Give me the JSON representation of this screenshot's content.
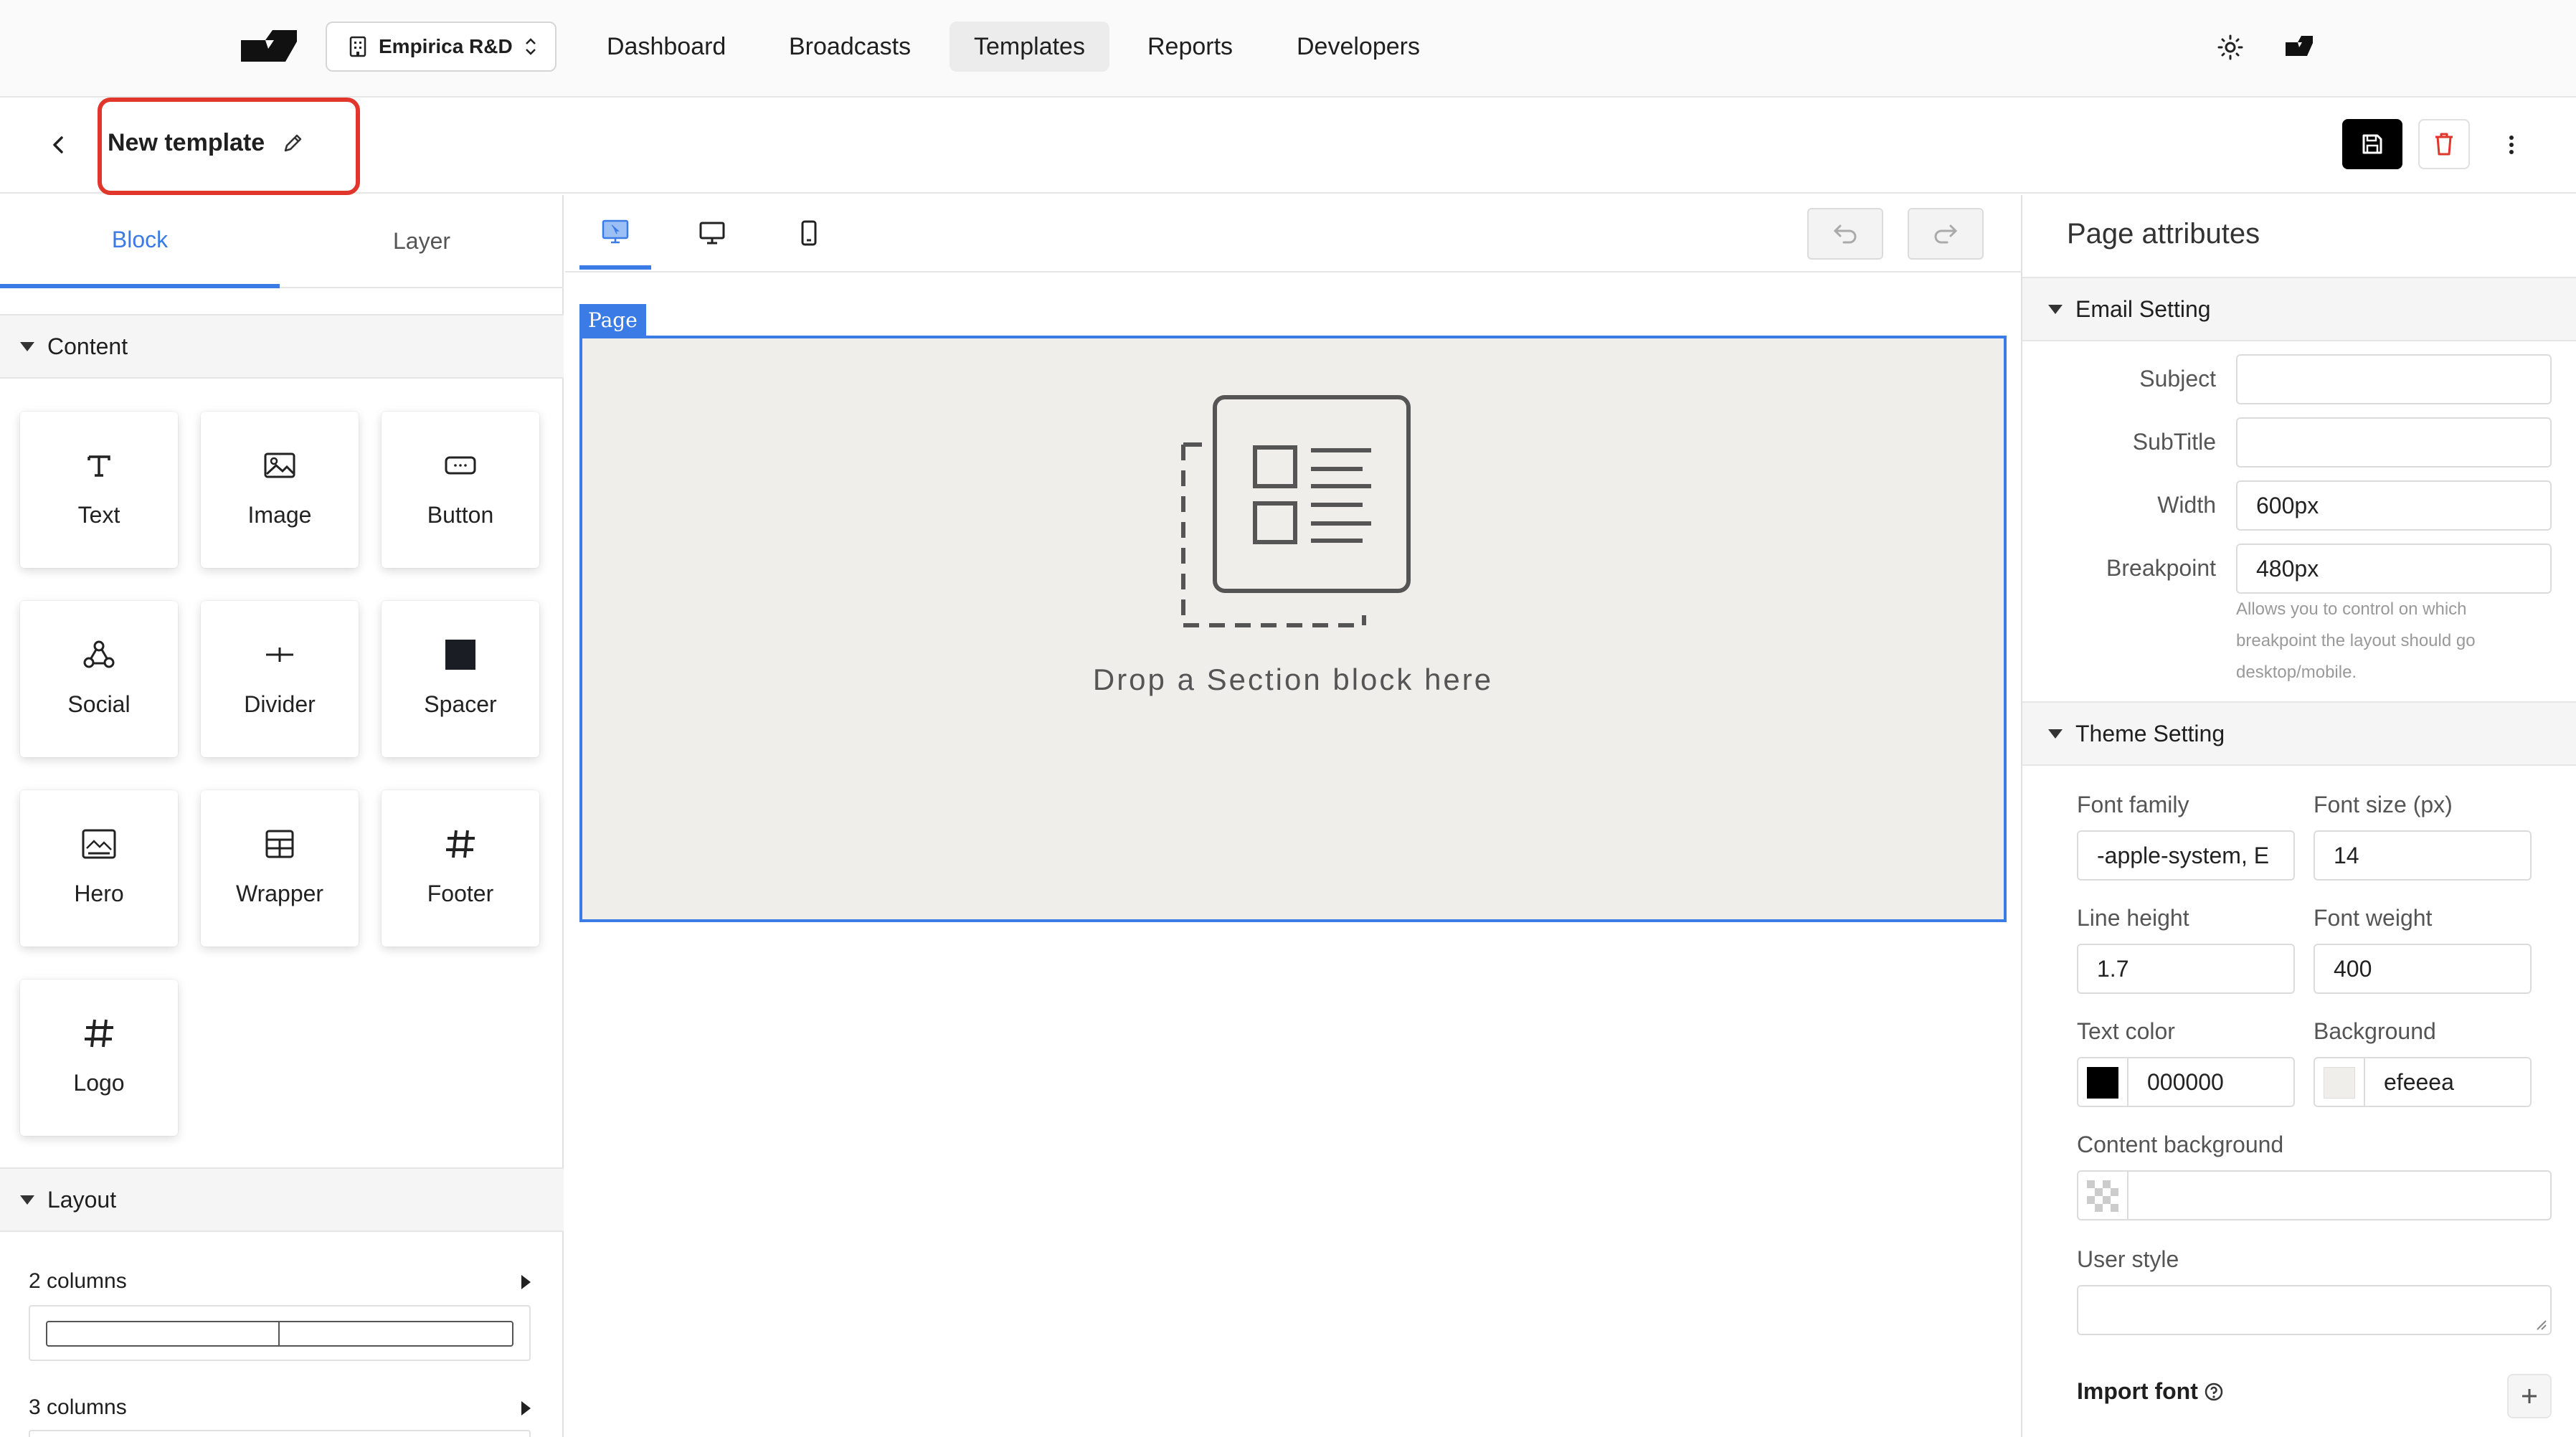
{
  "nav": {
    "org": "Empirica R&D",
    "links": [
      "Dashboard",
      "Broadcasts",
      "Templates",
      "Reports",
      "Developers"
    ],
    "active": "Templates"
  },
  "header": {
    "title": "New template"
  },
  "left_panel": {
    "tabs": [
      "Block",
      "Layer"
    ],
    "active_tab": "Block",
    "content_section": "Content",
    "blocks": [
      {
        "label": "Text",
        "icon": "text-icon"
      },
      {
        "label": "Image",
        "icon": "image-icon"
      },
      {
        "label": "Button",
        "icon": "button-icon"
      },
      {
        "label": "Social",
        "icon": "social-icon"
      },
      {
        "label": "Divider",
        "icon": "divider-icon"
      },
      {
        "label": "Spacer",
        "icon": "spacer-icon"
      },
      {
        "label": "Hero",
        "icon": "hero-icon"
      },
      {
        "label": "Wrapper",
        "icon": "wrapper-icon"
      },
      {
        "label": "Footer",
        "icon": "hash-icon"
      },
      {
        "label": "Logo",
        "icon": "hash-icon"
      }
    ],
    "layout_section": "Layout",
    "layouts": [
      "2 columns",
      "3 columns"
    ]
  },
  "canvas": {
    "page_tag": "Page",
    "drop_text": "Drop a Section block here",
    "page_background": "#efeeea",
    "accent": "#3a7be5"
  },
  "right_panel": {
    "title": "Page attributes",
    "email_setting": {
      "heading": "Email Setting",
      "subject_label": "Subject",
      "subject_value": "",
      "subtitle_label": "SubTitle",
      "subtitle_value": "",
      "width_label": "Width",
      "width_value": "600px",
      "breakpoint_label": "Breakpoint",
      "breakpoint_value": "480px",
      "breakpoint_hint": [
        "Allows you to control on which",
        "breakpoint the layout should go",
        "desktop/mobile."
      ]
    },
    "theme_setting": {
      "heading": "Theme Setting",
      "font_family_label": "Font family",
      "font_family_value": "-apple-system, E",
      "font_size_label": "Font size (px)",
      "font_size_value": "14",
      "line_height_label": "Line height",
      "line_height_value": "1.7",
      "font_weight_label": "Font weight",
      "font_weight_value": "400",
      "text_color_label": "Text color",
      "text_color_value": "000000",
      "text_color_hex": "#000000",
      "background_label": "Background",
      "background_value": "efeeea",
      "background_hex": "#efeeea",
      "content_bg_label": "Content background",
      "content_bg_value": "",
      "user_style_label": "User style",
      "user_style_value": "",
      "import_font_label": "Import font"
    }
  }
}
